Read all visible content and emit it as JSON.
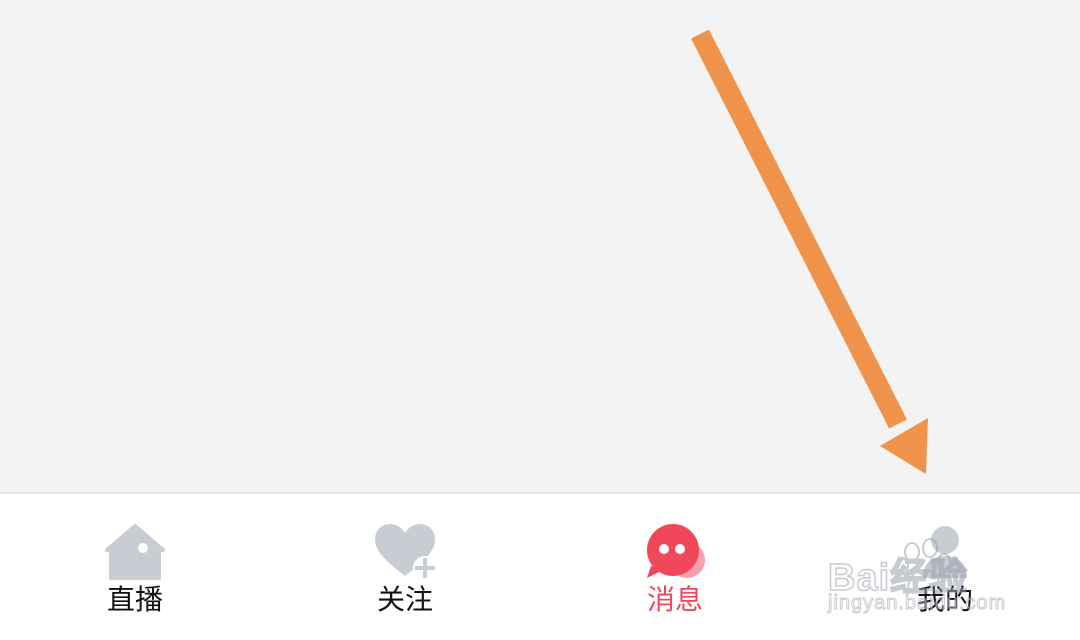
{
  "tabs": [
    {
      "label": "直播",
      "icon": "house-icon",
      "active": false
    },
    {
      "label": "关注",
      "icon": "heart-plus-icon",
      "active": false
    },
    {
      "label": "消息",
      "icon": "chat-bubble-icon",
      "active": true
    },
    {
      "label": "我的",
      "icon": "person-icon",
      "active": false
    }
  ],
  "watermark": {
    "brand": "Bai经验",
    "subtext": "jingyan.baidu.com"
  },
  "colors": {
    "accent": "#f0485a",
    "inactive_icon": "#c8ccd3",
    "arrow": "#f0934a",
    "background": "#f4f3f4"
  }
}
